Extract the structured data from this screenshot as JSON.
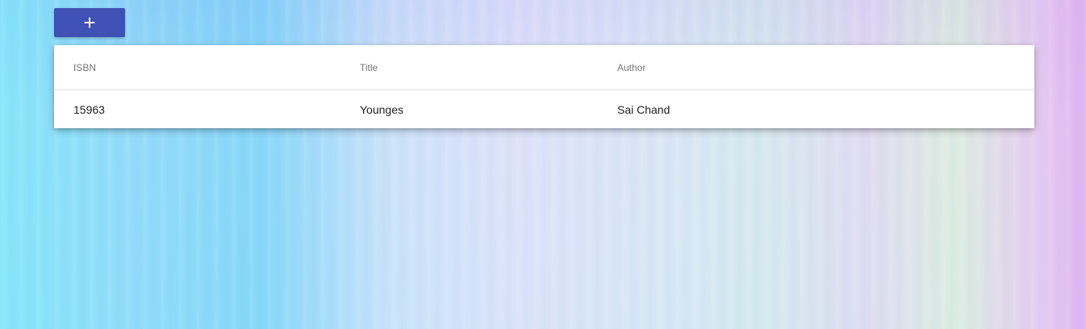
{
  "toolbar": {
    "add_label": "+"
  },
  "table": {
    "columns": [
      "ISBN",
      "Title",
      "Author"
    ],
    "rows": [
      [
        "15963",
        "Younges",
        "Sai Chand"
      ]
    ]
  },
  "colors": {
    "primary": "#3f51b5",
    "card_background": "#ffffff",
    "header_text": "#757575",
    "body_text": "#212121"
  }
}
